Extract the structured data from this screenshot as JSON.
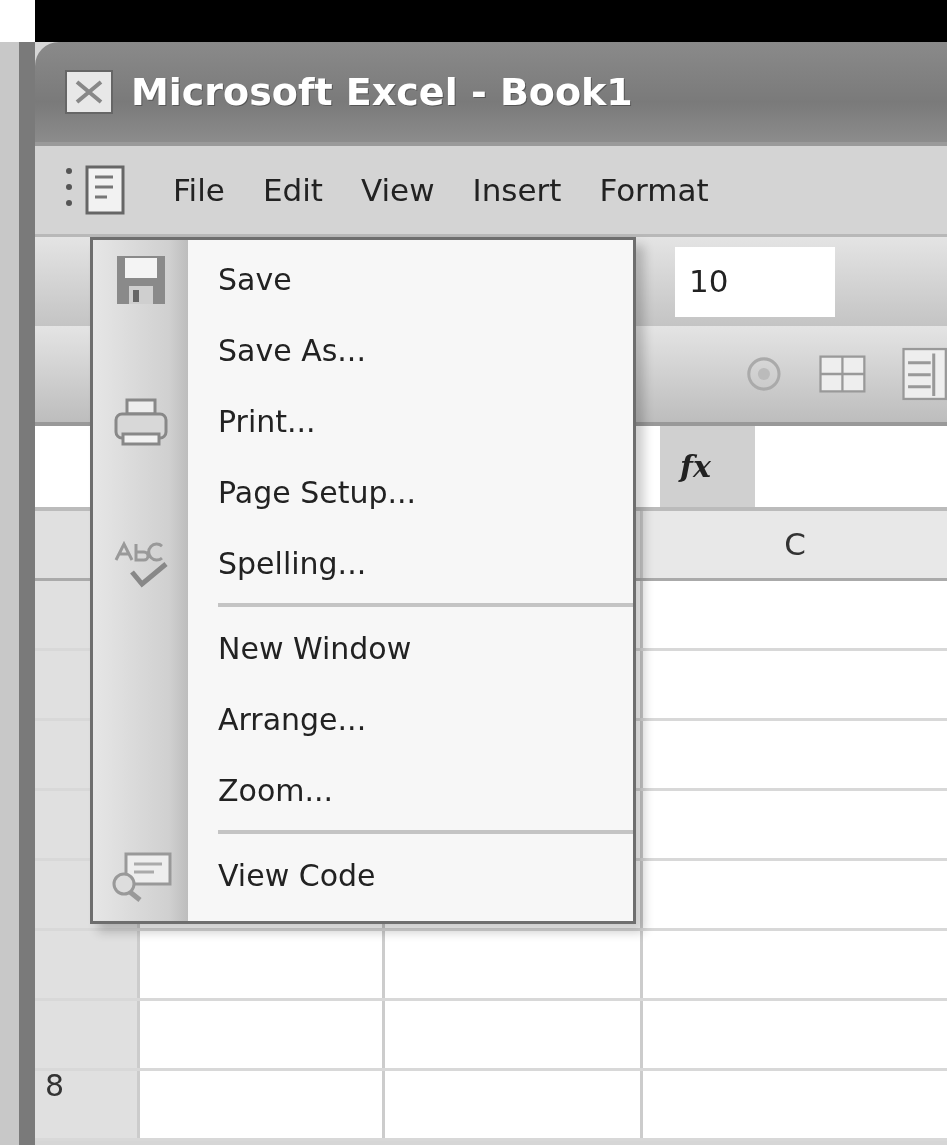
{
  "window": {
    "title": "Microsoft Excel - Book1"
  },
  "menu_bar": [
    {
      "label": "File"
    },
    {
      "label": "Edit"
    },
    {
      "label": "View"
    },
    {
      "label": "Insert"
    },
    {
      "label": "Format"
    }
  ],
  "toolbar": {
    "font_size": "10"
  },
  "formula_bar": {
    "function_label": "fx"
  },
  "sheet": {
    "columns": [
      "C"
    ],
    "row_numbers": [
      "8"
    ]
  },
  "file_menu": {
    "items": [
      {
        "kind": "save",
        "label": "Save"
      },
      {
        "kind": "plain",
        "label": "Save As..."
      },
      {
        "kind": "print",
        "label": "Print..."
      },
      {
        "kind": "plain",
        "label": "Page Setup..."
      },
      {
        "kind": "spelling",
        "label": "Spelling..."
      },
      {
        "kind": "separator"
      },
      {
        "kind": "plain",
        "label": "New Window"
      },
      {
        "kind": "plain",
        "label": "Arrange..."
      },
      {
        "kind": "plain",
        "label": "Zoom..."
      },
      {
        "kind": "separator"
      },
      {
        "kind": "code",
        "label": "View Code"
      }
    ]
  }
}
